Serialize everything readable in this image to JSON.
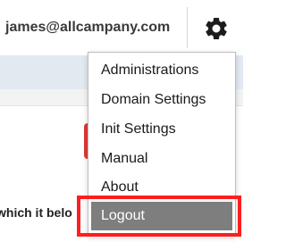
{
  "header": {
    "user_email": "james@allcampany.com",
    "settings_icon": "gear-icon"
  },
  "content": {
    "truncated_text": "which it belo"
  },
  "menu": {
    "items": [
      {
        "label": "Administrations",
        "active": false
      },
      {
        "label": "Domain Settings",
        "active": false
      },
      {
        "label": "Init Settings",
        "active": false
      },
      {
        "label": "Manual",
        "active": false
      },
      {
        "label": "About",
        "active": false
      },
      {
        "label": "Logout",
        "active": true
      }
    ]
  },
  "colors": {
    "highlight": "#ff1e1e",
    "active_item_bg": "#7e7e7e",
    "accent_red": "#e03a36",
    "nav_band": "#e3e9f1"
  }
}
